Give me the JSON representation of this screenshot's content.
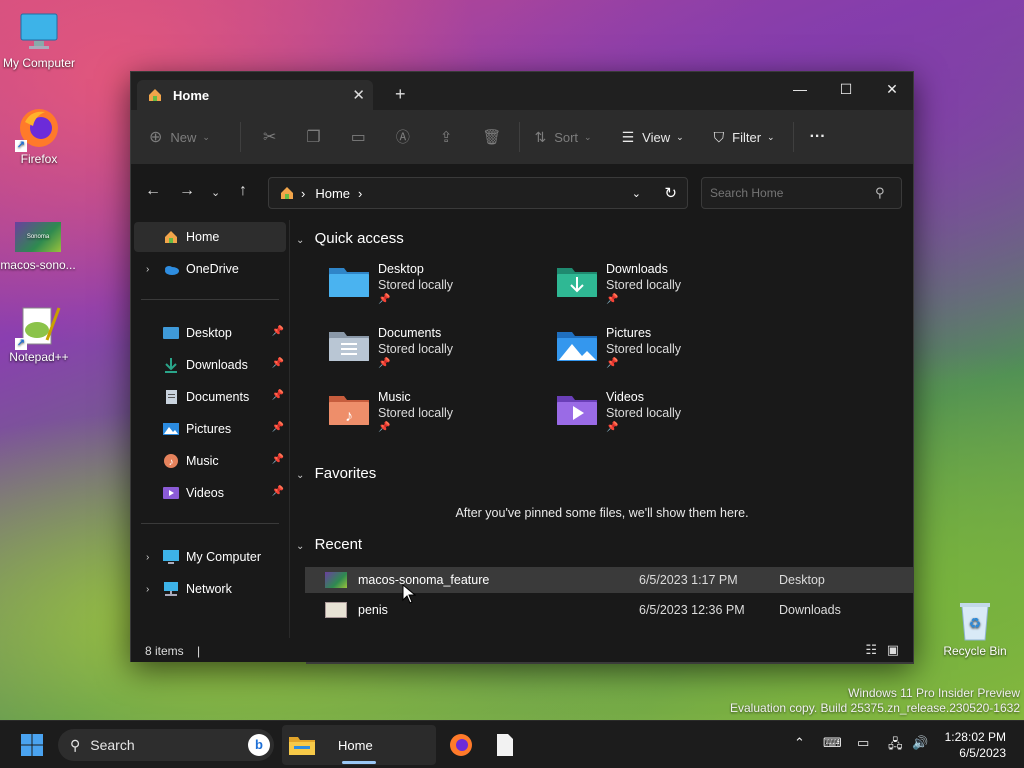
{
  "desktop": {
    "icons": [
      {
        "label": "My Computer",
        "icon": "monitor-icon"
      },
      {
        "label": "Firefox",
        "icon": "firefox-icon"
      },
      {
        "label": "macos-sono...",
        "icon": "image-thumbnail-icon"
      },
      {
        "label": "Notepad++",
        "icon": "notepad-plus-icon"
      },
      {
        "label": "Recycle Bin",
        "icon": "recycle-bin-icon"
      }
    ],
    "thumbnail_text": "Sonoma",
    "watermark": {
      "line1": "Windows 11 Pro Insider Preview",
      "line2": "Evaluation copy. Build 25375.zn_release.230520-1632"
    }
  },
  "window": {
    "tab_title": "Home",
    "tab_close": "✕",
    "new_tab": "+",
    "controls": {
      "minimize": "—",
      "maximize": "☐",
      "close": "✕"
    },
    "toolbar": {
      "new_label": "New",
      "sort_label": "Sort",
      "view_label": "View",
      "filter_label": "Filter",
      "more_label": "···"
    },
    "address": {
      "crumb": "Home",
      "sep": "›",
      "search_placeholder": "Search Home"
    },
    "sidebar": {
      "home": "Home",
      "onedrive": "OneDrive",
      "pinned": [
        {
          "label": "Desktop"
        },
        {
          "label": "Downloads"
        },
        {
          "label": "Documents"
        },
        {
          "label": "Pictures"
        },
        {
          "label": "Music"
        },
        {
          "label": "Videos"
        }
      ],
      "my_computer": "My Computer",
      "network": "Network"
    },
    "sections": {
      "quick_access": "Quick access",
      "favorites": "Favorites",
      "recent": "Recent",
      "favorites_empty": "After you've pinned some files, we'll show them here."
    },
    "quick_access_items": [
      {
        "name": "Desktop",
        "sub": "Stored locally"
      },
      {
        "name": "Downloads",
        "sub": "Stored locally"
      },
      {
        "name": "Documents",
        "sub": "Stored locally"
      },
      {
        "name": "Pictures",
        "sub": "Stored locally"
      },
      {
        "name": "Music",
        "sub": "Stored locally"
      },
      {
        "name": "Videos",
        "sub": "Stored locally"
      }
    ],
    "recent_items": [
      {
        "name": "macos-sonoma_feature",
        "date": "6/5/2023 1:17 PM",
        "location": "Desktop"
      },
      {
        "name": "penis",
        "date": "6/5/2023 12:36 PM",
        "location": "Downloads"
      }
    ],
    "status": {
      "count": "8 items"
    }
  },
  "taskbar": {
    "search_label": "Search",
    "home_label": "Home",
    "time": "1:28:02 PM",
    "date": "6/5/2023"
  },
  "colors": {
    "accent": "#4aa3f0",
    "folder_blue": "#3f9ad9",
    "folder_green": "#2aa58a",
    "folder_orange": "#e5825c",
    "folder_purple": "#8b5bd6"
  }
}
